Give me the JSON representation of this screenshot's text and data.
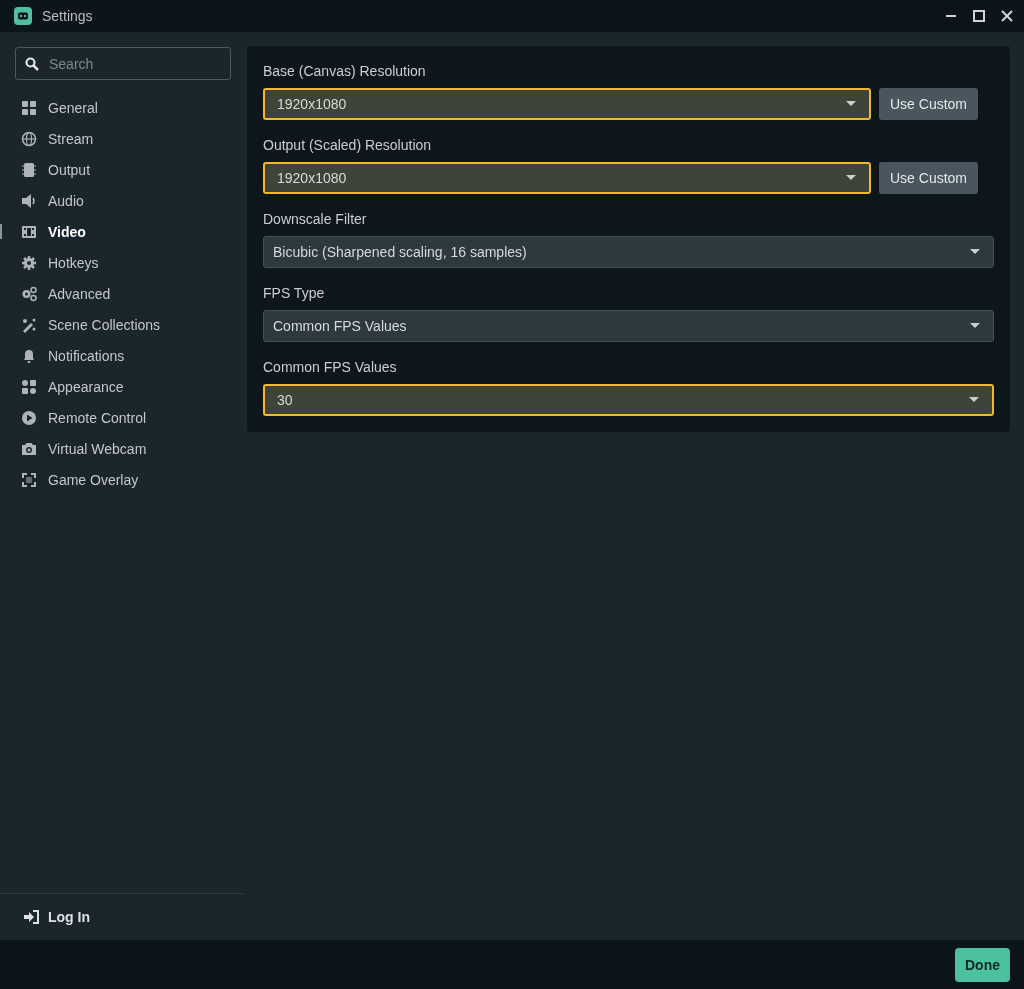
{
  "window": {
    "title": "Settings"
  },
  "sidebar": {
    "search": {
      "placeholder": "Search"
    },
    "items": [
      {
        "label": "General",
        "selected": false
      },
      {
        "label": "Stream",
        "selected": false
      },
      {
        "label": "Output",
        "selected": false
      },
      {
        "label": "Audio",
        "selected": false
      },
      {
        "label": "Video",
        "selected": true
      },
      {
        "label": "Hotkeys",
        "selected": false
      },
      {
        "label": "Advanced",
        "selected": false
      },
      {
        "label": "Scene Collections",
        "selected": false
      },
      {
        "label": "Notifications",
        "selected": false
      },
      {
        "label": "Appearance",
        "selected": false
      },
      {
        "label": "Remote Control",
        "selected": false
      },
      {
        "label": "Virtual Webcam",
        "selected": false
      },
      {
        "label": "Game Overlay",
        "selected": false
      }
    ],
    "login": "Log In"
  },
  "settings": [
    {
      "label": "Base (Canvas) Resolution",
      "value": "1920x1080",
      "highlighted": true,
      "button": "Use Custom"
    },
    {
      "label": "Output (Scaled) Resolution",
      "value": "1920x1080",
      "highlighted": true,
      "button": "Use Custom"
    },
    {
      "label": "Downscale Filter",
      "value": "Bicubic (Sharpened scaling, 16 samples)",
      "highlighted": false
    },
    {
      "label": "FPS Type",
      "value": "Common FPS Values",
      "highlighted": false
    },
    {
      "label": "Common FPS Values",
      "value": "30",
      "highlighted": true
    }
  ],
  "footer": {
    "done": "Done"
  }
}
